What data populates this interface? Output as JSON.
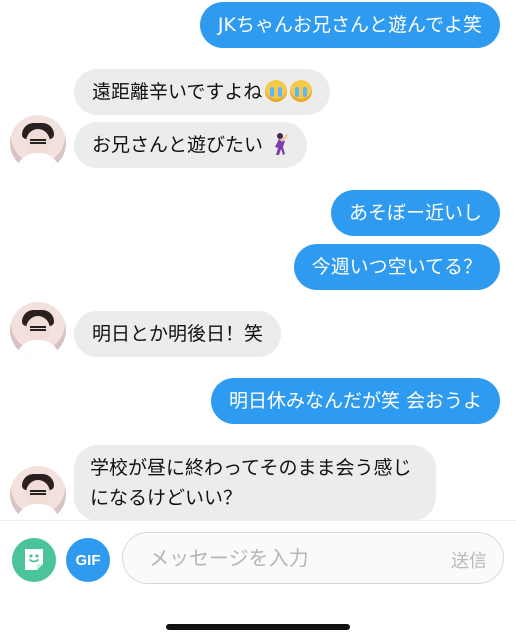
{
  "messages": [
    {
      "side": "sent",
      "text": "JKちゃんお兄さんと遊んでよ笑"
    },
    {
      "side": "received",
      "text": "遠距離辛いですよね",
      "emoji": [
        "loudly-crying-face-icon",
        "loudly-crying-face-icon"
      ]
    },
    {
      "side": "received",
      "text": "お兄さんと遊びたい",
      "emoji": [
        "dancer-icon"
      ]
    },
    {
      "side": "sent",
      "text": "あそぼー近いし"
    },
    {
      "side": "sent",
      "text": "今週いつ空いてる？"
    },
    {
      "side": "received",
      "text": "明日とか明後日！笑"
    },
    {
      "side": "sent",
      "text": "明日休みなんだが笑 会おうよ"
    },
    {
      "side": "received",
      "text": "学校が昼に終わってそのまま会う感じになるけどいい？"
    }
  ],
  "composer": {
    "gif_label": "GIF",
    "placeholder": "メッセージを入力",
    "send_label": "送信"
  },
  "colors": {
    "sent_bubble": "#2f9bf0",
    "received_bubble": "#ececec",
    "sticker_button": "#4bc49c",
    "gif_button": "#2f9bf0"
  }
}
